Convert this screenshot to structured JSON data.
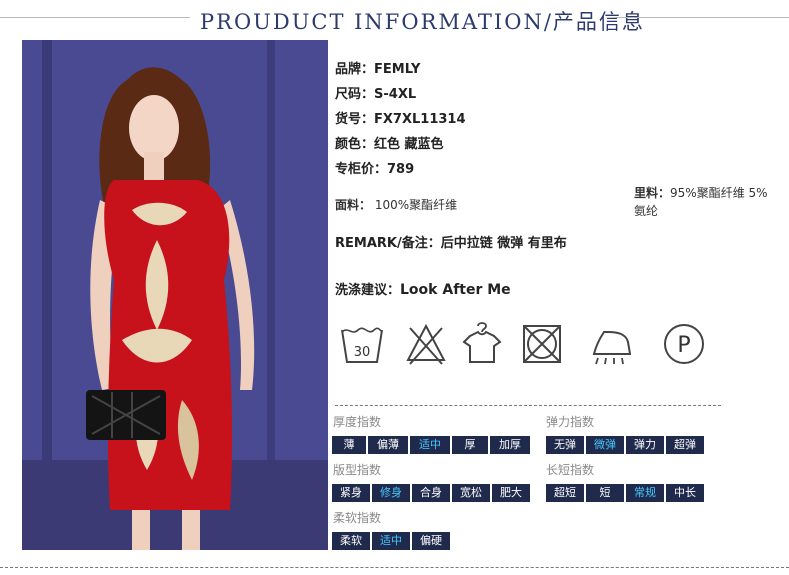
{
  "header": {
    "title": "PROUDUCT INFORMATION/产品信息"
  },
  "specs": {
    "brand": {
      "label": "品牌：",
      "value": "FEMLY"
    },
    "size": {
      "label": "尺码：",
      "value": "S-4XL"
    },
    "sku": {
      "label": "货号：",
      "value": "FX7XL11314"
    },
    "color": {
      "label": "颜色：",
      "value": "红色 藏蓝色"
    },
    "price": {
      "label": "专柜价：",
      "value": "789"
    },
    "fabric": {
      "label": "面料：",
      "value": "100%聚酯纤维"
    },
    "lining": {
      "label": "里料：",
      "value": "95%聚酯纤维 5%",
      "value2": "氨纶"
    },
    "remark": {
      "label": "REMARK/备注：",
      "value": "后中拉链 微弹 有里布"
    },
    "wash": {
      "label": "洗涤建议：",
      "value": "Look After Me"
    }
  },
  "care": {
    "wash_temp": "30",
    "dry_clean_letter": "P"
  },
  "indices": {
    "thickness": {
      "label": "厚度指数",
      "options": [
        "薄",
        "偏薄",
        "适中",
        "厚",
        "加厚"
      ],
      "selected": 2
    },
    "elasticity": {
      "label": "弹力指数",
      "options": [
        "无弹",
        "微弹",
        "弹力",
        "超弹"
      ],
      "selected": 1
    },
    "fit": {
      "label": "版型指数",
      "options": [
        "紧身",
        "修身",
        "合身",
        "宽松",
        "肥大"
      ],
      "selected": 1
    },
    "length": {
      "label": "长短指数",
      "options": [
        "超短",
        "短",
        "常规",
        "中长"
      ],
      "selected": 2
    },
    "softness": {
      "label": "柔软指数",
      "options": [
        "柔软",
        "适中",
        "偏硬"
      ],
      "selected": 1
    }
  },
  "colors": {
    "accent": "#2c3a6e",
    "chip_bg": "#1f2a4c",
    "chip_selected_text": "#47c8ff",
    "dress": "#c7111b"
  }
}
